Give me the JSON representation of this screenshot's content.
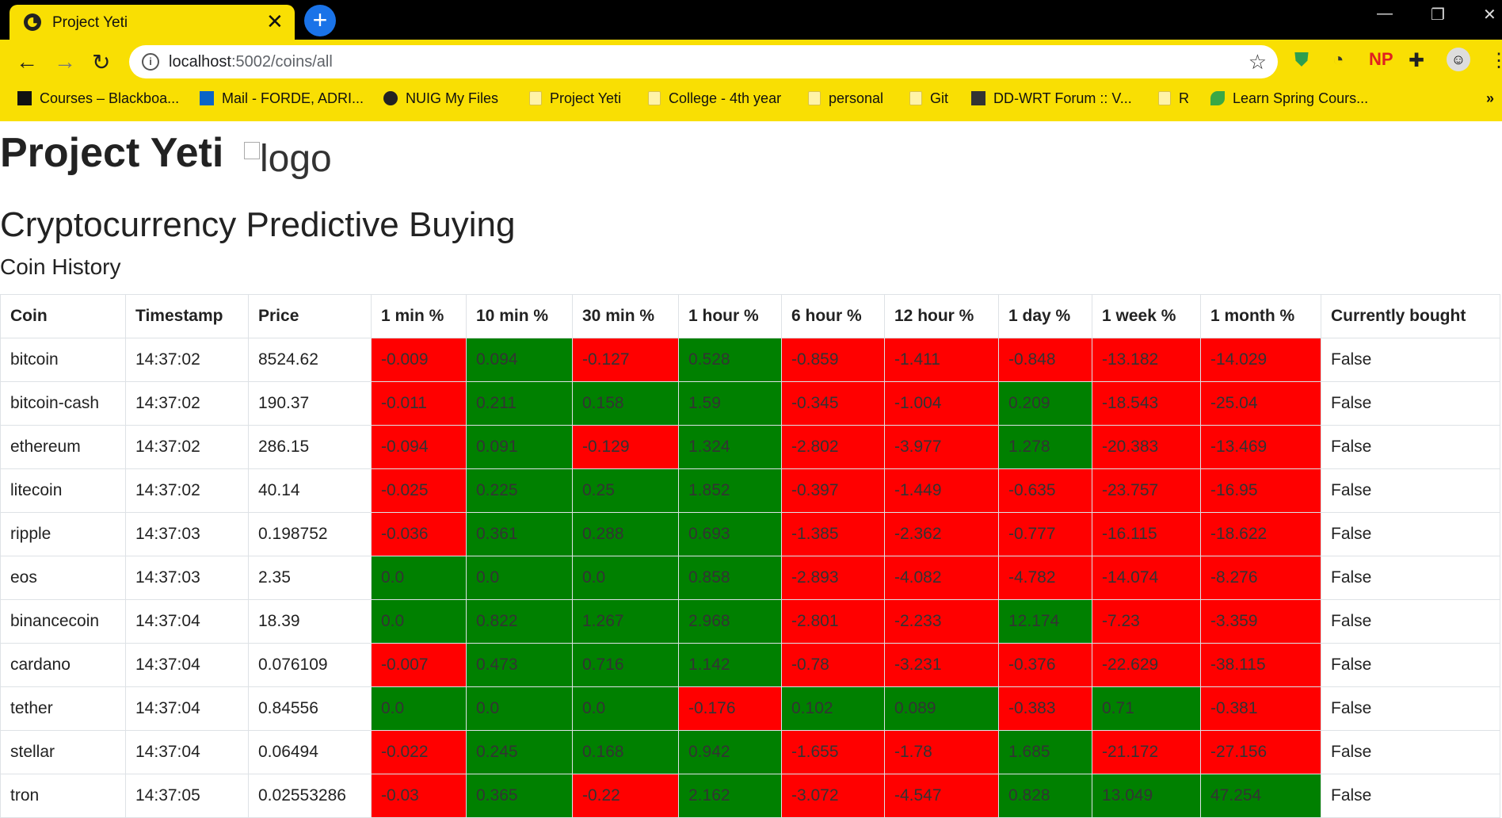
{
  "browser": {
    "tab_title": "Project Yeti",
    "new_tab": "+",
    "url_host": "localhost",
    "url_path": ":5002/coins/all",
    "bookmarks": [
      "Courses – Blackboa...",
      "Mail - FORDE, ADRI...",
      "NUIG My Files",
      "Project Yeti",
      "College - 4th year",
      "personal",
      "Git",
      "DD-WRT Forum :: V...",
      "R",
      "Learn Spring Cours..."
    ],
    "ext_np": "NP"
  },
  "page": {
    "title": "Project Yeti",
    "logo_alt": "logo",
    "subtitle": "Cryptocurrency Predictive Buying",
    "section": "Coin History"
  },
  "table": {
    "headers": [
      "Coin",
      "Timestamp",
      "Price",
      "1 min %",
      "10 min %",
      "30 min %",
      "1 hour %",
      "6 hour %",
      "12 hour %",
      "1 day %",
      "1 week %",
      "1 month %",
      "Currently bought"
    ],
    "rows": [
      [
        "bitcoin",
        "14:37:02",
        "8524.62",
        "-0.009",
        "0.094",
        "-0.127",
        "0.528",
        "-0.859",
        "-1.411",
        "-0.848",
        "-13.182",
        "-14.029",
        "False"
      ],
      [
        "bitcoin-cash",
        "14:37:02",
        "190.37",
        "-0.011",
        "0.211",
        "0.158",
        "1.59",
        "-0.345",
        "-1.004",
        "0.209",
        "-18.543",
        "-25.04",
        "False"
      ],
      [
        "ethereum",
        "14:37:02",
        "286.15",
        "-0.094",
        "0.091",
        "-0.129",
        "1.324",
        "-2.802",
        "-3.977",
        "1.278",
        "-20.383",
        "-13.469",
        "False"
      ],
      [
        "litecoin",
        "14:37:02",
        "40.14",
        "-0.025",
        "0.225",
        "0.25",
        "1.852",
        "-0.397",
        "-1.449",
        "-0.635",
        "-23.757",
        "-16.95",
        "False"
      ],
      [
        "ripple",
        "14:37:03",
        "0.198752",
        "-0.036",
        "0.361",
        "0.288",
        "0.693",
        "-1.385",
        "-2.362",
        "-0.777",
        "-16.115",
        "-18.622",
        "False"
      ],
      [
        "eos",
        "14:37:03",
        "2.35",
        "0.0",
        "0.0",
        "0.0",
        "0.858",
        "-2.893",
        "-4.082",
        "-4.782",
        "-14.074",
        "-8.276",
        "False"
      ],
      [
        "binancecoin",
        "14:37:04",
        "18.39",
        "0.0",
        "0.822",
        "1.267",
        "2.968",
        "-2.801",
        "-2.233",
        "12.174",
        "-7.23",
        "-3.359",
        "False"
      ],
      [
        "cardano",
        "14:37:04",
        "0.076109",
        "-0.007",
        "0.473",
        "0.716",
        "1.142",
        "-0.78",
        "-3.231",
        "-0.376",
        "-22.629",
        "-38.115",
        "False"
      ],
      [
        "tether",
        "14:37:04",
        "0.84556",
        "0.0",
        "0.0",
        "0.0",
        "-0.176",
        "0.102",
        "0.089",
        "-0.383",
        "0.71",
        "-0.381",
        "False"
      ],
      [
        "stellar",
        "14:37:04",
        "0.06494",
        "-0.022",
        "0.245",
        "0.168",
        "0.942",
        "-1.655",
        "-1.78",
        "1.685",
        "-21.172",
        "-27.156",
        "False"
      ],
      [
        "tron",
        "14:37:05",
        "0.02553286",
        "-0.03",
        "0.365",
        "-0.22",
        "2.162",
        "-3.072",
        "-4.547",
        "0.828",
        "13.049",
        "47.254",
        "False"
      ]
    ]
  },
  "colors": {
    "chrome": "#f9df03",
    "positive": "#008000",
    "negative": "#ff0000"
  }
}
